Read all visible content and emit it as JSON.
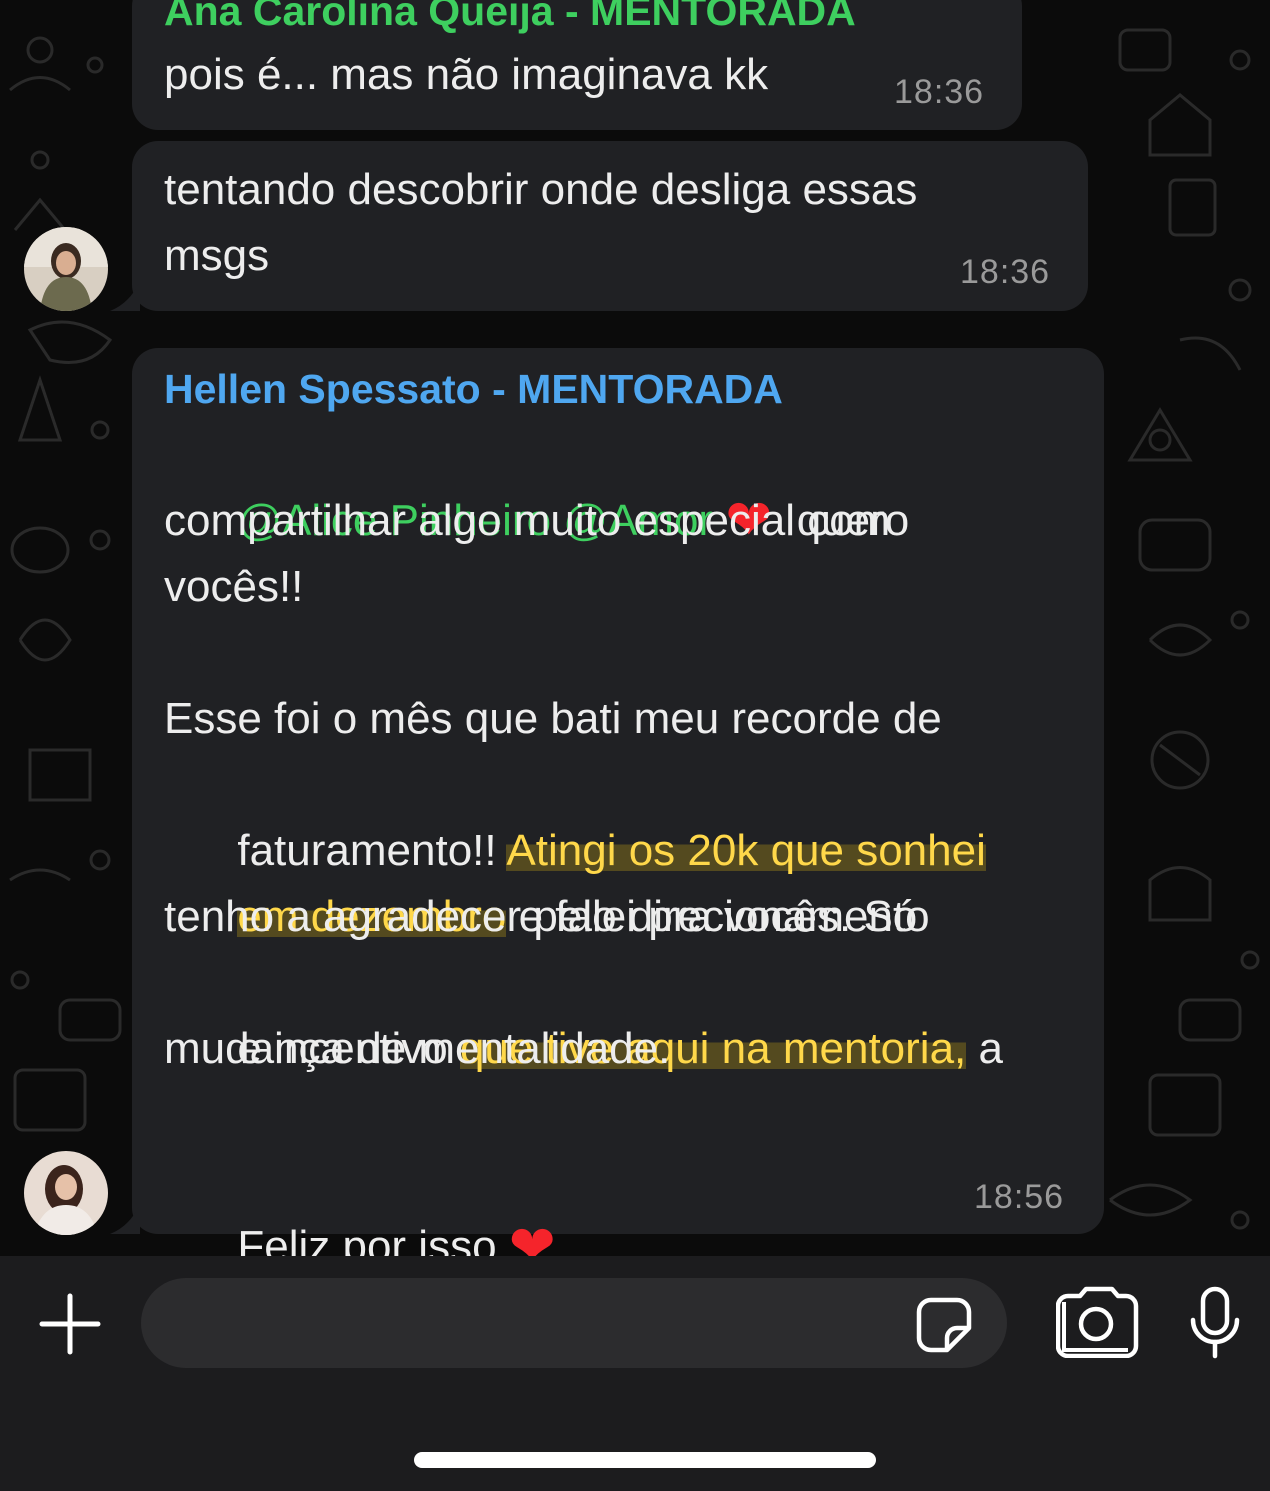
{
  "messages": [
    {
      "sender": "Ana Carolina Queija - MENTORADA",
      "text": "pois é... mas não imaginava kk",
      "time": "18:36"
    },
    {
      "text_line1": "tentando descobrir onde desliga essas",
      "text_line2": "msgs",
      "time": "18:36"
    },
    {
      "sender": "Hellen Spessato - MENTORADA",
      "mention1": "@Alice Pinheiro",
      "mention2": "@Amor",
      "heart1": "❤",
      "after_heart": "quero",
      "line2": "compartilhar algo muito especial com",
      "line3": "vocês!!",
      "line4": "Esse foi o mês que bati meu recorde de",
      "line5_plain": "faturamento!! ",
      "line5_hl": "Atingi os 20k que sonhei",
      "line6_hl": "em dezembro",
      "line6_plain": " e falei pra vocês. Só",
      "line7": "tenho a agradecer pelo direcionamento",
      "line8_plain": "e incentivo ",
      "line8_hl": "que tive aqui na mentoria,",
      "line8_end": " a",
      "line9": "mudança de mentalidade.",
      "line10": "Feliz por isso",
      "heart2": "❤",
      "time": "18:56"
    }
  ],
  "colors": {
    "sender1": "#3ecf5f",
    "sender2": "#4fa7f0",
    "mention": "#3ecf5f",
    "highlight": "#ffd84a",
    "heart": "#f5242b"
  },
  "icons": {
    "attach": "plus-icon",
    "sticker": "sticker-icon",
    "camera": "camera-icon",
    "mic": "microphone-icon"
  }
}
